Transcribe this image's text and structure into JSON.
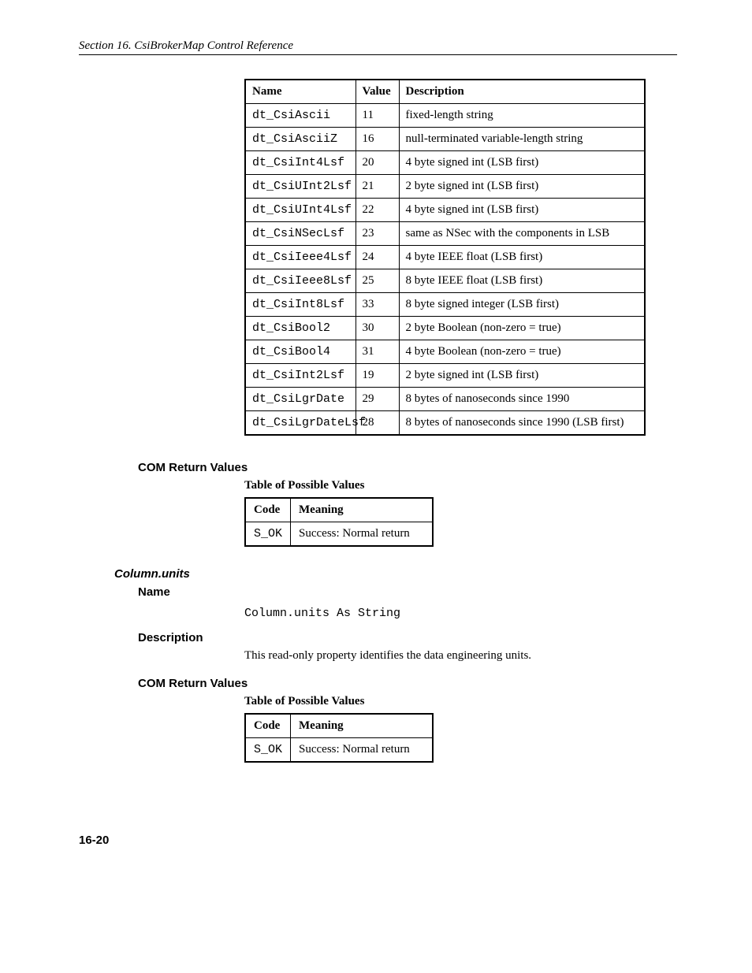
{
  "running_head": "Section 16.  CsiBrokerMap Control Reference",
  "main_table": {
    "headers": {
      "name": "Name",
      "value": "Value",
      "description": "Description"
    },
    "rows": [
      {
        "name": "dt_CsiAscii",
        "value": "11",
        "desc": "fixed-length string"
      },
      {
        "name": "dt_CsiAsciiZ",
        "value": "16",
        "desc": "null-terminated variable-length string"
      },
      {
        "name": "dt_CsiInt4Lsf",
        "value": "20",
        "desc": "4 byte signed int (LSB first)"
      },
      {
        "name": "dt_CsiUInt2Lsf",
        "value": "21",
        "desc": "2 byte signed int (LSB first)"
      },
      {
        "name": "dt_CsiUInt4Lsf",
        "value": "22",
        "desc": "4 byte signed int (LSB first)"
      },
      {
        "name": "dt_CsiNSecLsf",
        "value": "23",
        "desc": "same as NSec with the components in LSB"
      },
      {
        "name": "dt_CsiIeee4Lsf",
        "value": "24",
        "desc": "4 byte IEEE float (LSB first)"
      },
      {
        "name": "dt_CsiIeee8Lsf",
        "value": "25",
        "desc": "8 byte IEEE float (LSB first)"
      },
      {
        "name": "dt_CsiInt8Lsf",
        "value": "33",
        "desc": "8 byte signed integer (LSB first)"
      },
      {
        "name": "dt_CsiBool2",
        "value": "30",
        "desc": "2 byte Boolean (non-zero = true)"
      },
      {
        "name": "dt_CsiBool4",
        "value": "31",
        "desc": "4 byte Boolean (non-zero = true)"
      },
      {
        "name": "dt_CsiInt2Lsf",
        "value": "19",
        "desc": "2 byte signed int (LSB first)"
      },
      {
        "name": "dt_CsiLgrDate",
        "value": "29",
        "desc": "8 bytes of nanoseconds since 1990"
      },
      {
        "name": "dt_CsiLgrDateLsf",
        "value": "28",
        "desc": "8 bytes of nanoseconds since 1990 (LSB first)"
      }
    ]
  },
  "section1_heading": "COM Return Values",
  "section1_subhead": "Table of Possible Values",
  "small_table1": {
    "headers": {
      "code": "Code",
      "meaning": "Meaning"
    },
    "rows": [
      {
        "code": "S_OK",
        "meaning": "Success: Normal return"
      }
    ]
  },
  "column_units_heading": "Column.units",
  "name_heading": "Name",
  "signature": "Column.units As String",
  "desc_heading": "Description",
  "desc_text": "This read-only property identifies the data engineering units.",
  "section2_heading": "COM Return Values",
  "section2_subhead": "Table of Possible Values",
  "small_table2": {
    "headers": {
      "code": "Code",
      "meaning": "Meaning"
    },
    "rows": [
      {
        "code": "S_OK",
        "meaning": "Success: Normal return"
      }
    ]
  },
  "page_number": "16-20"
}
